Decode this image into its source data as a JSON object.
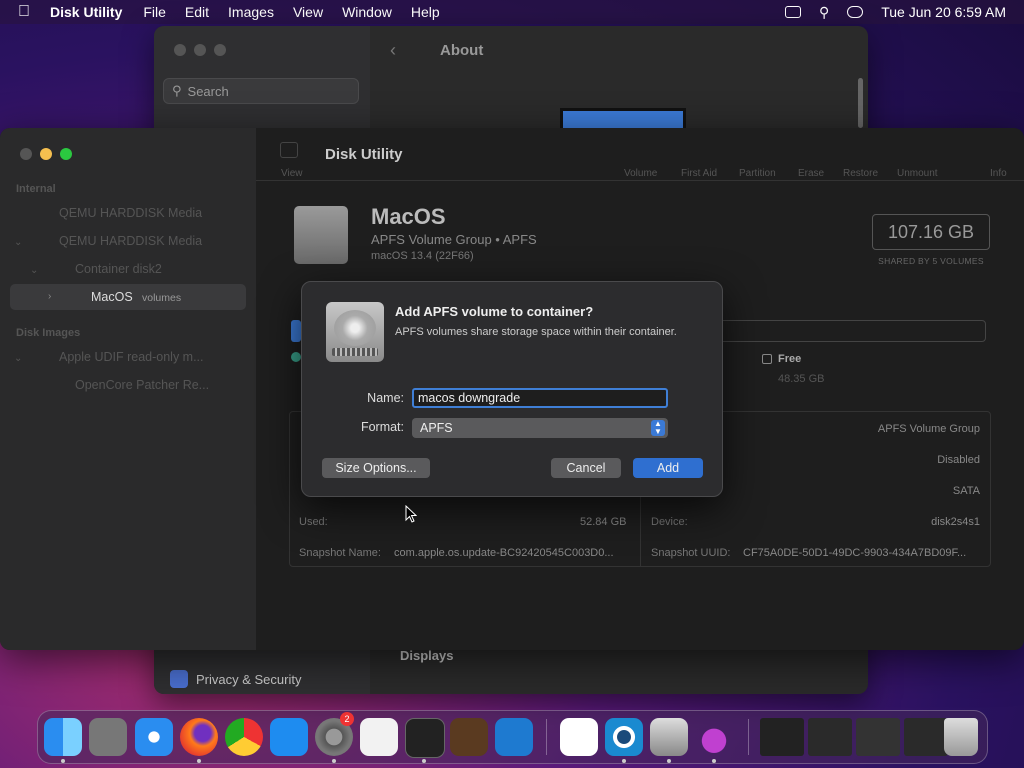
{
  "menubar": {
    "app": "Disk Utility",
    "items": [
      "File",
      "Edit",
      "Images",
      "View",
      "Window",
      "Help"
    ],
    "datetime": "Tue Jun 20  6:59 AM"
  },
  "bg_window": {
    "search_placeholder": "Search",
    "about": "About",
    "privacy": "Privacy & Security",
    "displays": "Displays"
  },
  "window": {
    "title": "Disk Utility",
    "view_label": "View",
    "toolbar": [
      "Volume",
      "First Aid",
      "Partition",
      "Erase",
      "Restore",
      "Unmount",
      "Info"
    ],
    "sidebar": {
      "internal_header": "Internal",
      "disk_images_header": "Disk Images",
      "items": [
        "QEMU HARDDISK Media",
        "QEMU HARDDISK Media",
        "Container disk2",
        "MacOS",
        "Apple UDIF read-only m...",
        "OpenCore Patcher Re..."
      ],
      "selected_suffix": "volumes"
    },
    "volume": {
      "name": "MacOS",
      "subtitle": "APFS Volume Group • APFS",
      "os": "macOS 13.4 (22F66)",
      "capacity": "107.16 GB",
      "capacity_note": "SHARED BY 5 VOLUMES",
      "free_label": "Free",
      "free_value": "48.35 GB"
    },
    "info": {
      "right_values": [
        "APFS Volume Group",
        "Disabled",
        "SATA"
      ],
      "used_label": "Used:",
      "used_value": "52.84 GB",
      "device_label": "Device:",
      "device_value": "disk2s4s1",
      "snapshot_name_label": "Snapshot Name:",
      "snapshot_name_value": "com.apple.os.update-BC92420545C003D0...",
      "snapshot_uuid_label": "Snapshot UUID:",
      "snapshot_uuid_value": "CF75A0DE-50D1-49DC-9903-434A7BD09F..."
    }
  },
  "dialog": {
    "title": "Add APFS volume to container?",
    "message": "APFS volumes share storage space within their container.",
    "name_label": "Name:",
    "name_value": "macos downgrade",
    "format_label": "Format:",
    "format_value": "APFS",
    "size_options": "Size Options...",
    "cancel": "Cancel",
    "add": "Add"
  },
  "dock": {
    "settings_badge": "2",
    "apps": [
      "finder-icon",
      "launchpad-icon",
      "safari-icon",
      "firefox-icon",
      "chrome-icon",
      "app-store-icon",
      "system-settings-icon",
      "textedit-icon",
      "terminal-icon",
      "garageband-icon",
      "vscode-icon",
      "visual-studio-icon",
      "opencore-icon",
      "disk-utility-icon",
      "installer-icon",
      "window-thumb-1",
      "window-thumb-2",
      "window-thumb-3",
      "window-thumb-4",
      "trash-icon"
    ]
  }
}
